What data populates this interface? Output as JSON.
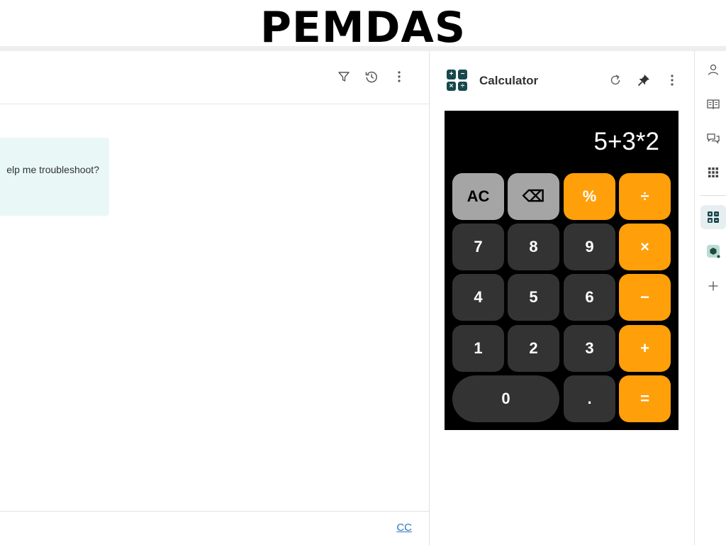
{
  "banner": {
    "title": "PEMDAS"
  },
  "chat": {
    "message_fragment": "elp me troubleshoot?",
    "footer_link": "CC",
    "toolbar": {
      "filter_icon": "filter-icon",
      "history_icon": "history-icon",
      "more_icon": "more-vertical-icon"
    }
  },
  "calculator_panel": {
    "title": "Calculator",
    "logo_glyphs": [
      "+",
      "−",
      "×",
      "÷"
    ],
    "display": "5+3*2",
    "keys": [
      {
        "label": "AC",
        "style": "light"
      },
      {
        "label": "⌫",
        "style": "light"
      },
      {
        "label": "%",
        "style": "orange"
      },
      {
        "label": "÷",
        "style": "orange"
      },
      {
        "label": "7",
        "style": "dark"
      },
      {
        "label": "8",
        "style": "dark"
      },
      {
        "label": "9",
        "style": "dark"
      },
      {
        "label": "×",
        "style": "orange"
      },
      {
        "label": "4",
        "style": "dark"
      },
      {
        "label": "5",
        "style": "dark"
      },
      {
        "label": "6",
        "style": "dark"
      },
      {
        "label": "−",
        "style": "orange"
      },
      {
        "label": "1",
        "style": "dark"
      },
      {
        "label": "2",
        "style": "dark"
      },
      {
        "label": "3",
        "style": "dark"
      },
      {
        "label": "+",
        "style": "orange"
      },
      {
        "label": "0",
        "style": "dark"
      },
      {
        "label": ".",
        "style": "dark"
      },
      {
        "label": "=",
        "style": "orange"
      }
    ],
    "colors": {
      "light": "#a5a5a5",
      "dark": "#333333",
      "orange": "#ff9f0a",
      "background": "#000000"
    }
  },
  "rail": {
    "items": [
      "person-icon",
      "book-icon",
      "chat-bubbles-icon",
      "apps-grid-icon",
      "calculator-icon",
      "cube-app-icon",
      "add-icon"
    ],
    "active": "calculator-icon"
  }
}
